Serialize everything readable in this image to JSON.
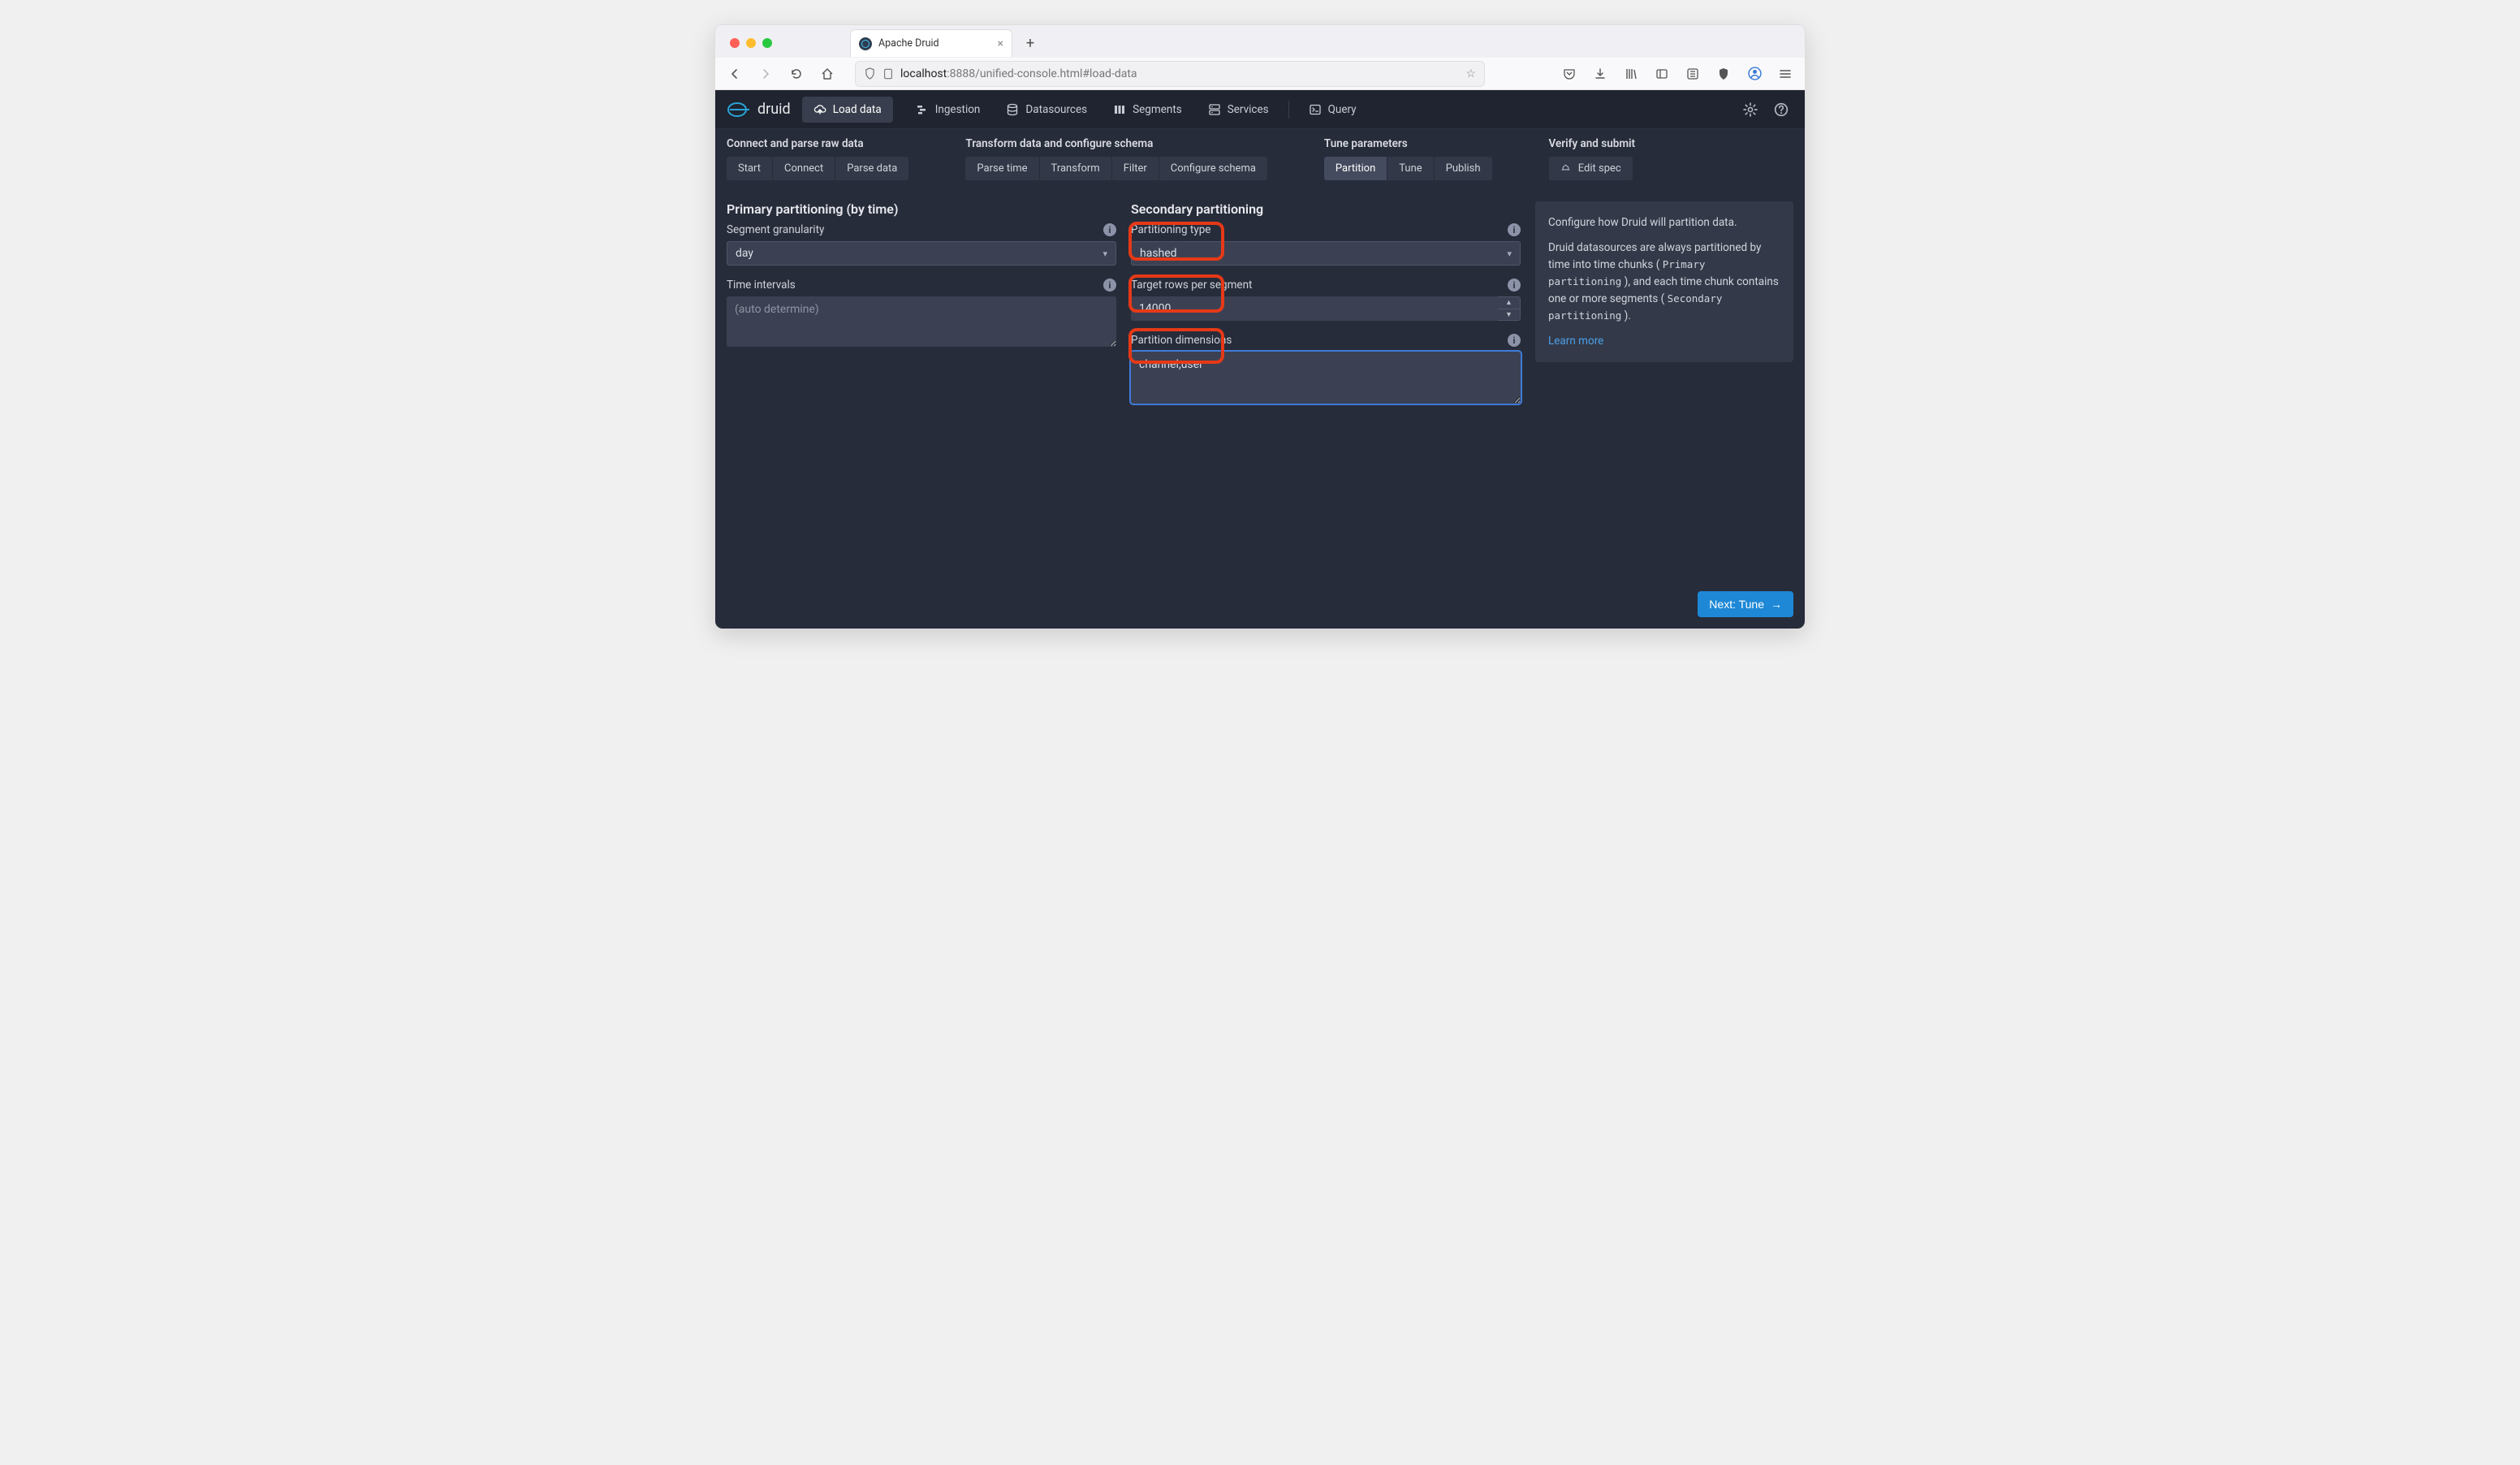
{
  "browser": {
    "tab_title": "Apache Druid",
    "url_host": "localhost",
    "url_path": ":8888/unified-console.html#load-data"
  },
  "nav": {
    "load_data": "Load data",
    "ingestion": "Ingestion",
    "datasources": "Datasources",
    "segments": "Segments",
    "services": "Services",
    "query": "Query"
  },
  "wizard": {
    "groups": {
      "connect": "Connect and parse raw data",
      "transform": "Transform data and configure schema",
      "tune": "Tune parameters",
      "verify": "Verify and submit"
    },
    "steps": {
      "start": "Start",
      "connect": "Connect",
      "parse_data": "Parse data",
      "parse_time": "Parse time",
      "transform": "Transform",
      "filter": "Filter",
      "configure_schema": "Configure schema",
      "partition": "Partition",
      "tune": "Tune",
      "publish": "Publish",
      "edit_spec": "Edit spec"
    }
  },
  "primary": {
    "title": "Primary partitioning (by time)",
    "segment_granularity_label": "Segment granularity",
    "segment_granularity_value": "day",
    "time_intervals_label": "Time intervals",
    "time_intervals_placeholder": "(auto determine)",
    "time_intervals_value": ""
  },
  "secondary": {
    "title": "Secondary partitioning",
    "partitioning_type_label": "Partitioning type",
    "partitioning_type_value": "hashed",
    "target_rows_label": "Target rows per segment",
    "target_rows_value": "14000",
    "partition_dimensions_label": "Partition dimensions",
    "partition_dimensions_value": "channel,user"
  },
  "help": {
    "line1": "Configure how Druid will partition data.",
    "line2a": "Druid datasources are always partitioned by time into time chunks ( ",
    "code1": "Primary partitioning",
    "line2b": " ), and each time chunk contains one or more segments ( ",
    "code2": "Secondary partitioning",
    "line2c": " ).",
    "learn_more": "Learn more"
  },
  "footer": {
    "next_label": "Next: Tune"
  }
}
